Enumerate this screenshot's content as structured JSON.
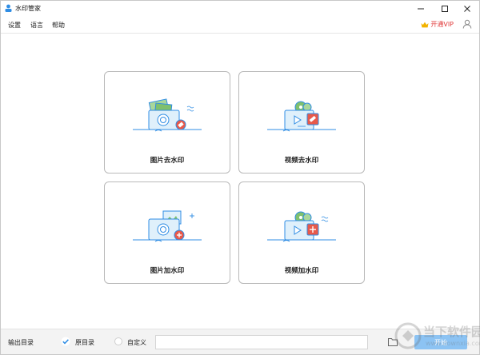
{
  "window": {
    "title": "水印管家",
    "controls": [
      "minimize",
      "maximize",
      "close"
    ]
  },
  "menu": [
    {
      "label": "设置"
    },
    {
      "label": "语言"
    },
    {
      "label": "帮助"
    }
  ],
  "vip": {
    "label": "开通VIP"
  },
  "cards": [
    {
      "label": "图片去水印",
      "icon": "photo-remove-watermark-icon"
    },
    {
      "label": "视频去水印",
      "icon": "video-remove-watermark-icon"
    },
    {
      "label": "图片加水印",
      "icon": "photo-add-watermark-icon"
    },
    {
      "label": "视频加水印",
      "icon": "video-add-watermark-icon"
    }
  ],
  "bottom": {
    "output_label": "输出目录",
    "option_original": "原目录",
    "option_custom": "自定义",
    "selected": "原目录",
    "path_value": "",
    "start_label": "开始"
  },
  "watermark": {
    "title": "当下软件园",
    "url": "www.downxia.com"
  },
  "colors": {
    "accent": "#2f8de4",
    "vip_text": "#e03a3a",
    "icon_red": "#e8594a",
    "icon_green": "#7fc06e",
    "start_button": "#8cc3f3"
  }
}
